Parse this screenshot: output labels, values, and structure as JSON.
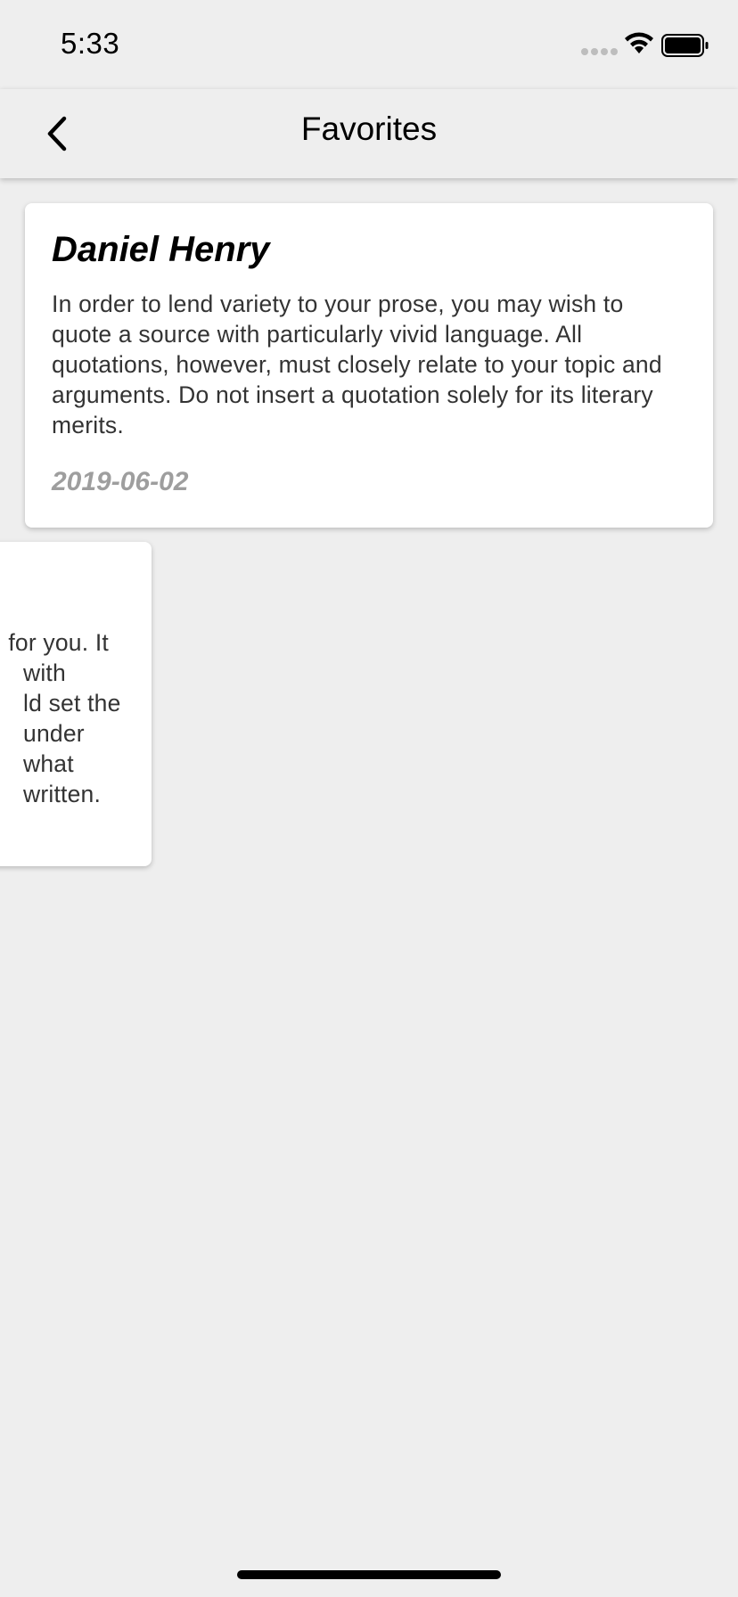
{
  "status_bar": {
    "time": "5:33"
  },
  "nav": {
    "title": "Favorites",
    "back_icon": "chevron-left-icon"
  },
  "cards": [
    {
      "author": "Daniel Henry",
      "quote": "In order to lend variety to your prose, you may wish to quote a source with particularly vivid language. All quotations, however, must closely relate to your topic and arguments. Do not insert a quotation solely for its literary merits.",
      "date": "2019-06-02"
    },
    {
      "quote_lines": [
        "for you. It",
        "with",
        "ld set the",
        "under what",
        "written."
      ]
    }
  ],
  "colors": {
    "background": "#eeeeee",
    "card": "#ffffff",
    "date": "#9e9e9e"
  }
}
